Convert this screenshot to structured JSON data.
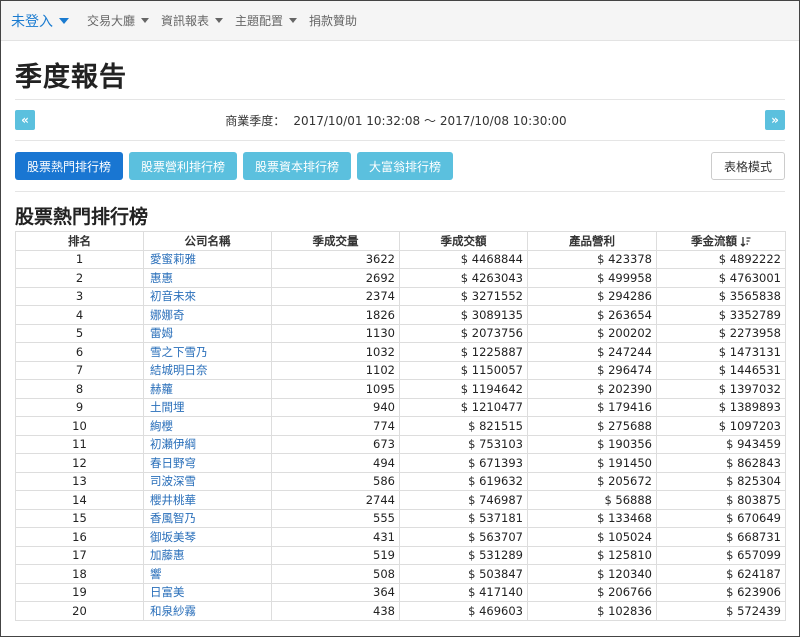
{
  "navbar": {
    "brand": "未登入",
    "items": [
      "交易大廳",
      "資訊報表",
      "主題配置"
    ],
    "donate": "捐款贊助"
  },
  "page": {
    "title": "季度報告"
  },
  "period": {
    "label": "商業季度：",
    "range": "2017/10/01 10:32:08 ～ 2017/10/08 10:30:00",
    "prev": "«",
    "next": "»"
  },
  "tabs": [
    "股票熱門排行榜",
    "股票營利排行榜",
    "股票資本排行榜",
    "大富翁排行榜"
  ],
  "table_mode_label": "表格模式",
  "section_title": "股票熱門排行榜",
  "table": {
    "headers": [
      "排名",
      "公司名稱",
      "季成交量",
      "季成交額",
      "產品營利",
      "季金流額"
    ],
    "rows": [
      [
        "1",
        "愛蜜莉雅",
        "3622",
        "$ 4468844",
        "$ 423378",
        "$ 4892222"
      ],
      [
        "2",
        "惠惠",
        "2692",
        "$ 4263043",
        "$ 499958",
        "$ 4763001"
      ],
      [
        "3",
        "初音未來",
        "2374",
        "$ 3271552",
        "$ 294286",
        "$ 3565838"
      ],
      [
        "4",
        "娜娜奇",
        "1826",
        "$ 3089135",
        "$ 263654",
        "$ 3352789"
      ],
      [
        "5",
        "雷姆",
        "1130",
        "$ 2073756",
        "$ 200202",
        "$ 2273958"
      ],
      [
        "6",
        "雪之下雪乃",
        "1032",
        "$ 1225887",
        "$ 247244",
        "$ 1473131"
      ],
      [
        "7",
        "結城明日奈",
        "1102",
        "$ 1150057",
        "$ 296474",
        "$ 1446531"
      ],
      [
        "8",
        "赫蘿",
        "1095",
        "$ 1194642",
        "$ 202390",
        "$ 1397032"
      ],
      [
        "9",
        "土間埋",
        "940",
        "$ 1210477",
        "$ 179416",
        "$ 1389893"
      ],
      [
        "10",
        "絢櫻",
        "774",
        "$ 821515",
        "$ 275688",
        "$ 1097203"
      ],
      [
        "11",
        "初瀬伊綱",
        "673",
        "$ 753103",
        "$ 190356",
        "$ 943459"
      ],
      [
        "12",
        "春日野穹",
        "494",
        "$ 671393",
        "$ 191450",
        "$ 862843"
      ],
      [
        "13",
        "司波深雪",
        "586",
        "$ 619632",
        "$ 205672",
        "$ 825304"
      ],
      [
        "14",
        "櫻井桃華",
        "2744",
        "$ 746987",
        "$ 56888",
        "$ 803875"
      ],
      [
        "15",
        "香風智乃",
        "555",
        "$ 537181",
        "$ 133468",
        "$ 670649"
      ],
      [
        "16",
        "御坂美琴",
        "431",
        "$ 563707",
        "$ 105024",
        "$ 668731"
      ],
      [
        "17",
        "加藤惠",
        "519",
        "$ 531289",
        "$ 125810",
        "$ 657099"
      ],
      [
        "18",
        "響",
        "508",
        "$ 503847",
        "$ 120340",
        "$ 624187"
      ],
      [
        "19",
        "日富美",
        "364",
        "$ 417140",
        "$ 206766",
        "$ 623906"
      ],
      [
        "20",
        "和泉紗霧",
        "438",
        "$ 469603",
        "$ 102836",
        "$ 572439"
      ]
    ]
  },
  "colors": {
    "primary": "#1976d2",
    "info": "#5bc0de",
    "link": "#2a6fba"
  },
  "icons": {
    "sort": "sort-descending-icon"
  }
}
